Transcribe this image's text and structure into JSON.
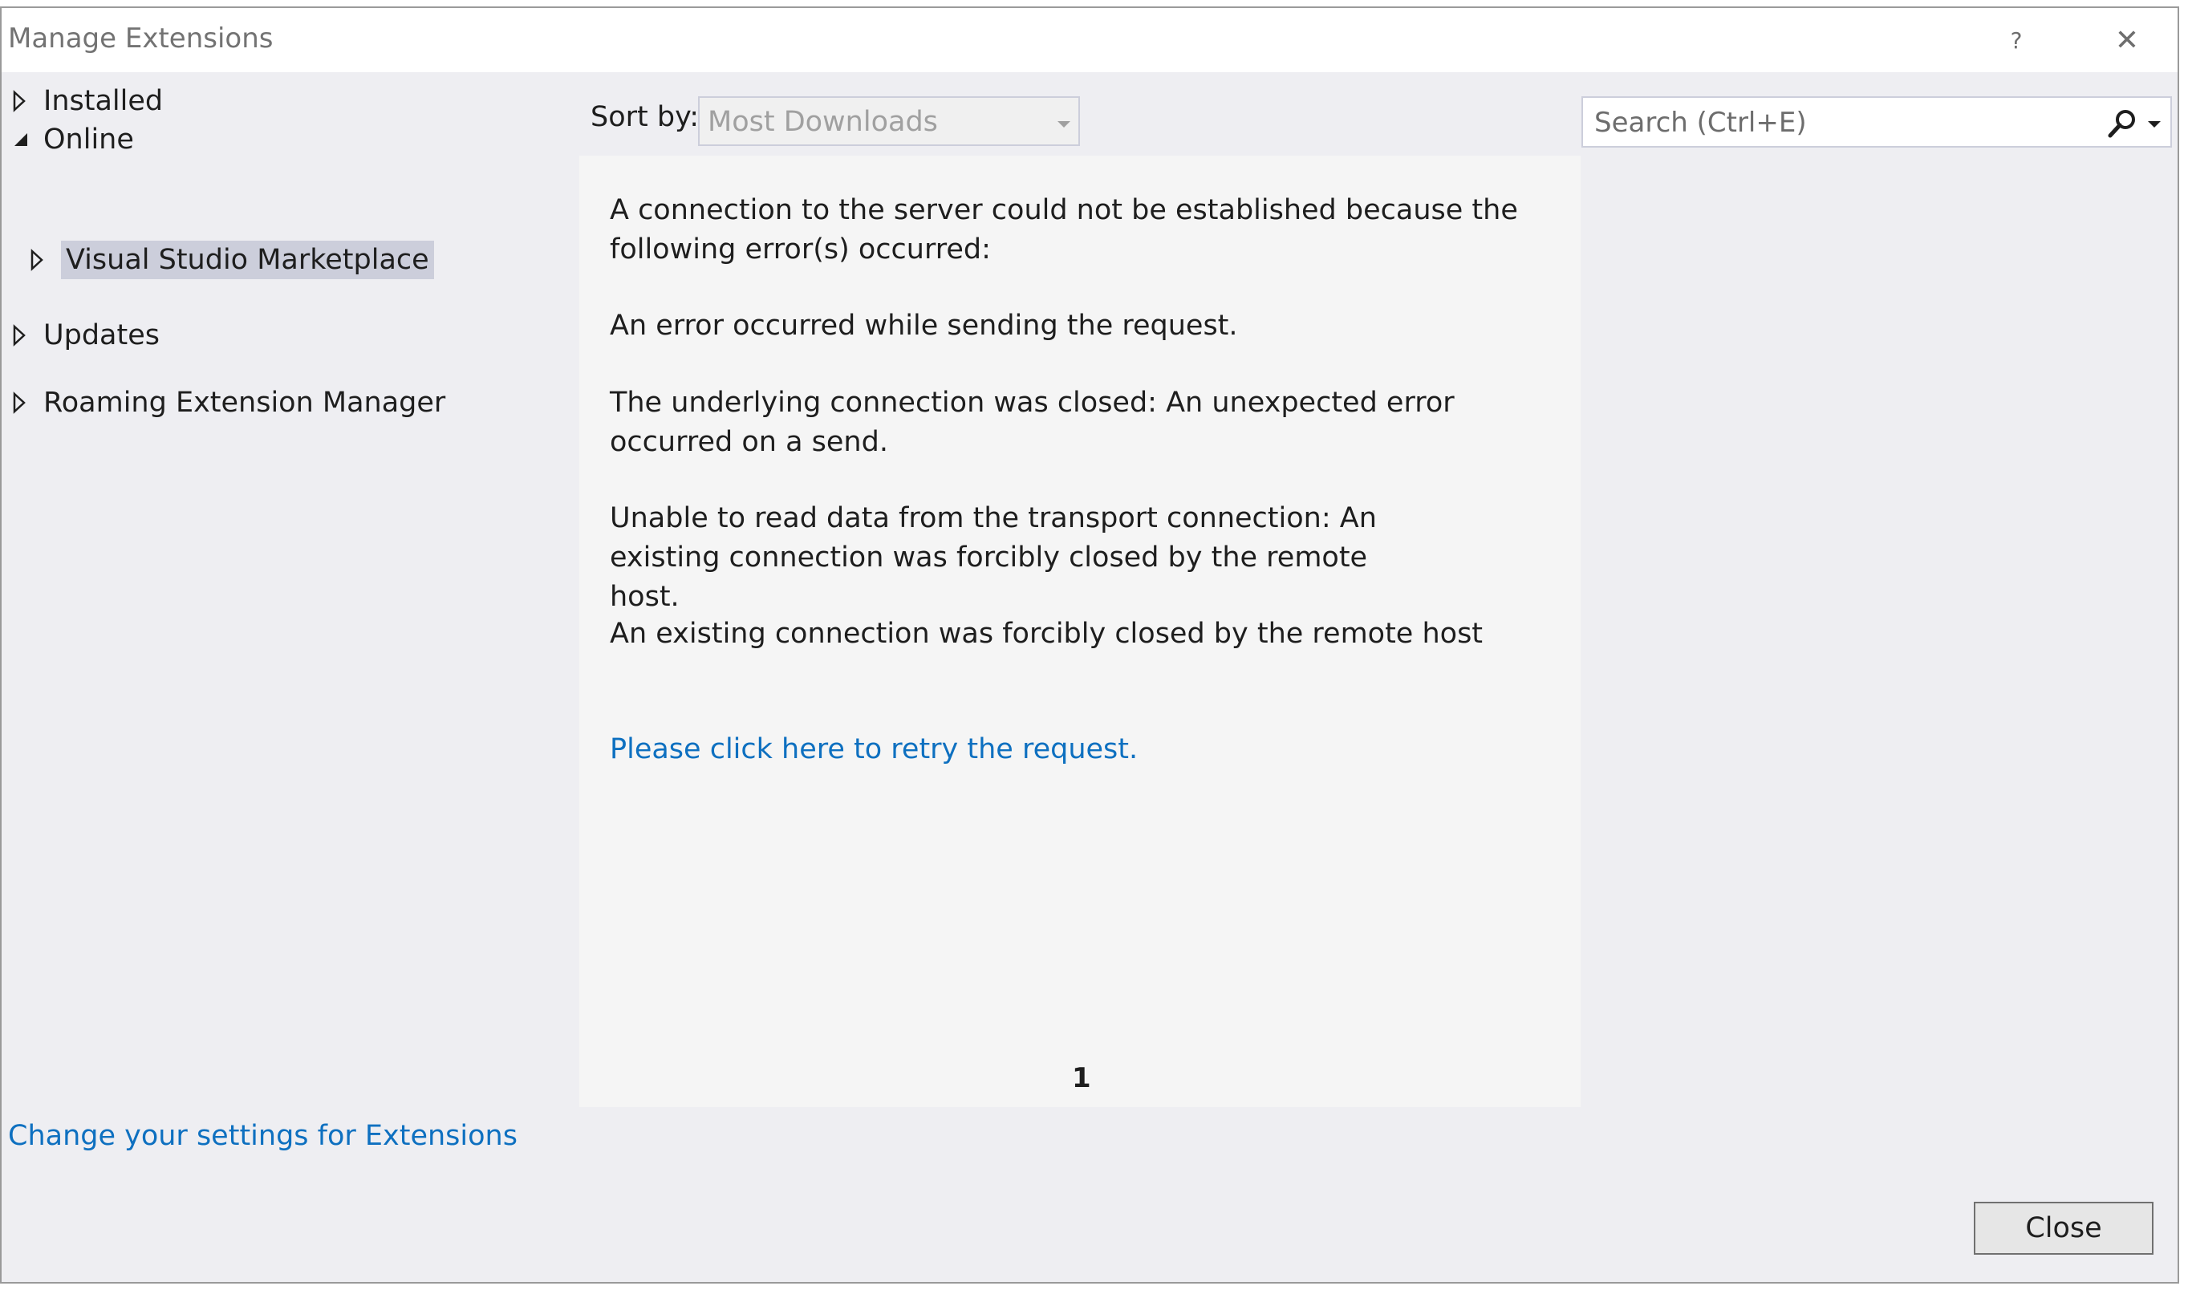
{
  "window": {
    "title": "Manage Extensions",
    "help_label": "?",
    "close_label": "✕"
  },
  "nav": {
    "items": [
      {
        "label": "Installed",
        "expanded": false
      },
      {
        "label": "Online",
        "expanded": true
      },
      {
        "label": "Visual Studio Marketplace",
        "expanded": false,
        "selected": true
      },
      {
        "label": "Updates",
        "expanded": false
      },
      {
        "label": "Roaming Extension Manager",
        "expanded": false
      }
    ]
  },
  "toolbar": {
    "sort_label": "Sort by:",
    "sort_value": "Most Downloads",
    "search_placeholder": "Search (Ctrl+E)"
  },
  "content": {
    "error_lines": [
      "A connection to the server could not be established because the following error(s) occurred:",
      "An error occurred while sending the request.",
      "The underlying connection was closed: An unexpected error occurred on a send.",
      "Unable to read data from the transport connection: An existing connection was forcibly closed by the remote host.",
      "An existing connection was forcibly closed by the remote host"
    ],
    "retry_link": "Please click here to retry the request.",
    "page_number": "1"
  },
  "footer": {
    "settings_link": "Change your settings for Extensions",
    "close_button": "Close"
  },
  "colors": {
    "link": "#0e70c0",
    "selection": "#cccedb",
    "panel": "#f5f5f5",
    "background": "#eeeef2"
  }
}
